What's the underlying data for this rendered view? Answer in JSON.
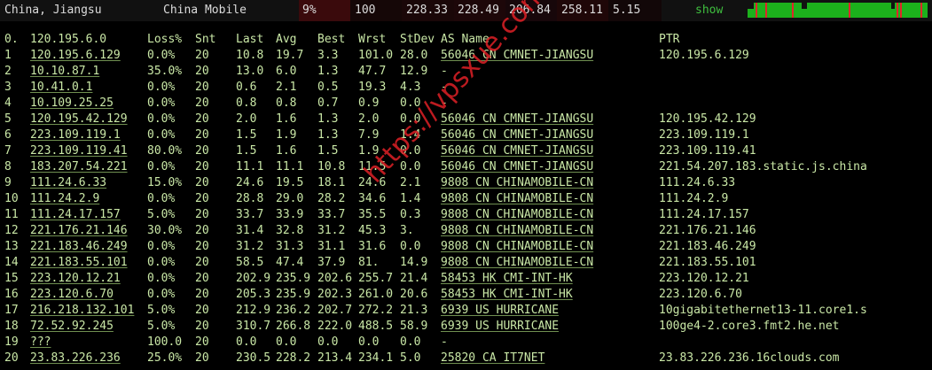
{
  "topbar": {
    "location": "China, Jiangsu",
    "isp": "China Mobile",
    "loss": "9%",
    "sent": "100",
    "last": "228.33",
    "avg": "228.49",
    "best": "206.84",
    "worst": "258.11",
    "stdev": "5.15",
    "show_label": "show"
  },
  "headers": {
    "hop": "0.",
    "host": "120.195.6.0",
    "loss": "Loss%",
    "snt": "Snt",
    "last": "Last",
    "avg": "Avg",
    "best": "Best",
    "wrst": "Wrst",
    "stdev": "StDev",
    "as": "AS Name",
    "ptr": "PTR"
  },
  "rows": [
    {
      "hop": "1",
      "host": "120.195.6.129",
      "loss": "0.0%",
      "snt": "20",
      "last": "10.8",
      "avg": "19.7",
      "best": "3.3",
      "wrst": "101.0",
      "stdev": "28.0",
      "as": "56046 CN CMNET-JIANGSU",
      "ptr": "120.195.6.129"
    },
    {
      "hop": "2",
      "host": "10.10.87.1",
      "loss": "35.0%",
      "snt": "20",
      "last": "13.0",
      "avg": "6.0",
      "best": "1.3",
      "wrst": "47.7",
      "stdev": "12.9",
      "as": "-",
      "ptr": ""
    },
    {
      "hop": "3",
      "host": "10.41.0.1",
      "loss": "0.0%",
      "snt": "20",
      "last": "0.6",
      "avg": "2.1",
      "best": "0.5",
      "wrst": "19.3",
      "stdev": "4.3",
      "as": "-",
      "ptr": ""
    },
    {
      "hop": "4",
      "host": "10.109.25.25",
      "loss": "0.0%",
      "snt": "20",
      "last": "0.8",
      "avg": "0.8",
      "best": "0.7",
      "wrst": "0.9",
      "stdev": "0.0",
      "as": "-",
      "ptr": ""
    },
    {
      "hop": "5",
      "host": "120.195.42.129",
      "loss": "0.0%",
      "snt": "20",
      "last": "2.0",
      "avg": "1.6",
      "best": "1.3",
      "wrst": "2.0",
      "stdev": "0.0",
      "as": "56046 CN CMNET-JIANGSU",
      "ptr": "120.195.42.129"
    },
    {
      "hop": "6",
      "host": "223.109.119.1",
      "loss": "0.0%",
      "snt": "20",
      "last": "1.5",
      "avg": "1.9",
      "best": "1.3",
      "wrst": "7.9",
      "stdev": "1.4",
      "as": "56046 CN CMNET-JIANGSU",
      "ptr": "223.109.119.1"
    },
    {
      "hop": "7",
      "host": "223.109.119.41",
      "loss": "80.0%",
      "snt": "20",
      "last": "1.5",
      "avg": "1.6",
      "best": "1.5",
      "wrst": "1.9",
      "stdev": "0.0",
      "as": "56046 CN CMNET-JIANGSU",
      "ptr": "223.109.119.41"
    },
    {
      "hop": "8",
      "host": "183.207.54.221",
      "loss": "0.0%",
      "snt": "20",
      "last": "11.1",
      "avg": "11.1",
      "best": "10.8",
      "wrst": "11.5",
      "stdev": "0.0",
      "as": "56046 CN CMNET-JIANGSU",
      "ptr": "221.54.207.183.static.js.china"
    },
    {
      "hop": "9",
      "host": "111.24.6.33",
      "loss": "15.0%",
      "snt": "20",
      "last": "24.6",
      "avg": "19.5",
      "best": "18.1",
      "wrst": "24.6",
      "stdev": "2.1",
      "as": "9808 CN CHINAMOBILE-CN",
      "ptr": "111.24.6.33"
    },
    {
      "hop": "10",
      "host": "111.24.2.9",
      "loss": "0.0%",
      "snt": "20",
      "last": "28.8",
      "avg": "29.0",
      "best": "28.2",
      "wrst": "34.6",
      "stdev": "1.4",
      "as": "9808 CN CHINAMOBILE-CN",
      "ptr": "111.24.2.9"
    },
    {
      "hop": "11",
      "host": "111.24.17.157",
      "loss": "5.0%",
      "snt": "20",
      "last": "33.7",
      "avg": "33.9",
      "best": "33.7",
      "wrst": "35.5",
      "stdev": "0.3",
      "as": "9808 CN CHINAMOBILE-CN",
      "ptr": "111.24.17.157"
    },
    {
      "hop": "12",
      "host": "221.176.21.146",
      "loss": "30.0%",
      "snt": "20",
      "last": "31.4",
      "avg": "32.8",
      "best": "31.2",
      "wrst": "45.3",
      "stdev": "3.",
      "as": "9808 CN CHINAMOBILE-CN",
      "ptr": "221.176.21.146"
    },
    {
      "hop": "13",
      "host": "221.183.46.249",
      "loss": "0.0%",
      "snt": "20",
      "last": "31.2",
      "avg": "31.3",
      "best": "31.1",
      "wrst": "31.6",
      "stdev": "0.0",
      "as": "9808 CN CHINAMOBILE-CN",
      "ptr": "221.183.46.249"
    },
    {
      "hop": "14",
      "host": "221.183.55.101",
      "loss": "0.0%",
      "snt": "20",
      "last": "58.5",
      "avg": "47.4",
      "best": "37.9",
      "wrst": "81.",
      "stdev": "14.9",
      "as": "9808 CN CHINAMOBILE-CN",
      "ptr": "221.183.55.101"
    },
    {
      "hop": "15",
      "host": "223.120.12.21",
      "loss": "0.0%",
      "snt": "20",
      "last": "202.9",
      "avg": "235.9",
      "best": "202.6",
      "wrst": "255.7",
      "stdev": "21.4",
      "as": "58453 HK CMI-INT-HK",
      "ptr": "223.120.12.21"
    },
    {
      "hop": "16",
      "host": "223.120.6.70",
      "loss": "0.0%",
      "snt": "20",
      "last": "205.3",
      "avg": "235.9",
      "best": "202.3",
      "wrst": "261.0",
      "stdev": "20.6",
      "as": "58453 HK CMI-INT-HK",
      "ptr": "223.120.6.70"
    },
    {
      "hop": "17",
      "host": "216.218.132.101",
      "loss": "5.0%",
      "snt": "20",
      "last": "212.9",
      "avg": "236.2",
      "best": "202.7",
      "wrst": "272.2",
      "stdev": "21.3",
      "as": "6939 US HURRICANE",
      "ptr": "10gigabitethernet13-11.core1.s"
    },
    {
      "hop": "18",
      "host": "72.52.92.245",
      "loss": "5.0%",
      "snt": "20",
      "last": "310.7",
      "avg": "266.8",
      "best": "222.0",
      "wrst": "488.5",
      "stdev": "58.9",
      "as": "6939 US HURRICANE",
      "ptr": "100ge4-2.core3.fmt2.he.net"
    },
    {
      "hop": "19",
      "host": "???",
      "loss": "100.0",
      "snt": "20",
      "last": "0.0",
      "avg": "0.0",
      "best": "0.0",
      "wrst": "0.0",
      "stdev": "0.0",
      "as": "-",
      "ptr": ""
    },
    {
      "hop": "20",
      "host": "23.83.226.236",
      "loss": "25.0%",
      "snt": "20",
      "last": "230.5",
      "avg": "228.2",
      "best": "213.4",
      "wrst": "234.1",
      "stdev": "5.0",
      "as": "25820 CA IT7NET",
      "ptr": "23.83.226.236.16clouds.com"
    }
  ],
  "watermark": "https://vpsxue.com",
  "colors": {
    "background": "#000000",
    "text": "#c9e7a6",
    "topbar_bg": "#111111",
    "sparkline_green": "#1cb11c",
    "sparkline_red": "#e0252b",
    "watermark": "#de2026"
  }
}
